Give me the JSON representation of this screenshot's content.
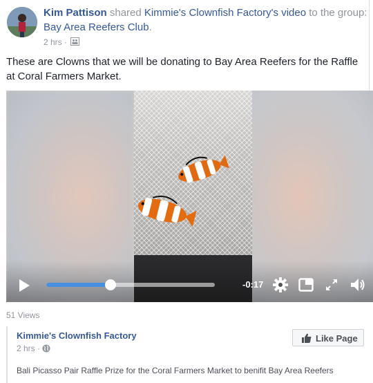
{
  "post": {
    "author": "Kim Pattison",
    "verb": "shared",
    "source": "Kimmie's Clownfish Factory",
    "possessive_video": "'s video",
    "to_the": "to the",
    "group_prefix": "group:",
    "group": "Bay Area Reefers Club",
    "period": ".",
    "time": "2 hrs",
    "audience_icon": "group-audience-icon",
    "caption_line1": "These are Clowns that we will be donating to Bay Area Reefers for the Raffle",
    "caption_line2": "at Coral Farmers Market."
  },
  "video": {
    "time_remaining": "-0:17",
    "progress": 0.38,
    "controls": [
      "play-icon",
      "settings-gear-icon",
      "picture-in-picture-icon",
      "fullscreen-icon",
      "volume-icon"
    ]
  },
  "views": "51 Views",
  "shared_page": {
    "name": "Kimmie's Clownfish Factory",
    "time": "2 hrs",
    "audience_icon": "globe-icon",
    "like_label": "Like Page",
    "description": "Bali Picasso Pair Raffle Prize for the Coral Farmers Market to benifit Bay Area Reefers"
  },
  "colors": {
    "link": "#365899",
    "muted": "#90949c",
    "progress": "#4a90e2"
  }
}
